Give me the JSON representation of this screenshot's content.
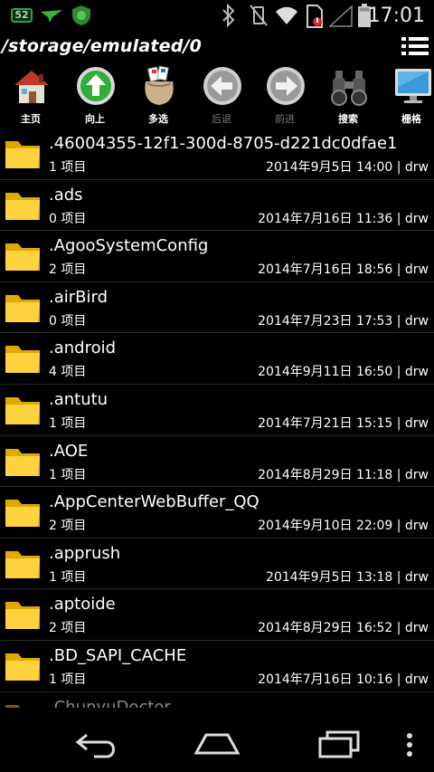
{
  "status_bar": {
    "badge": "52",
    "time": "17:01",
    "icons": [
      "bird-notification-icon",
      "shield-notification-icon",
      "bluetooth-icon",
      "vibrate-off-icon",
      "wifi-icon",
      "sim-error-icon",
      "signal-icon",
      "battery-icon"
    ]
  },
  "path": "/storage/emulated/0",
  "toolbar": {
    "home": "主页",
    "up": "向上",
    "multi": "多选",
    "back": "后退",
    "forward": "前进",
    "search": "搜索",
    "grid": "栅格"
  },
  "files": [
    {
      "name": ".46004355-12f1-300d-8705-d221dc0dfae1",
      "count": "1 项目",
      "meta": "2014年9月5日 14:00 | drw"
    },
    {
      "name": ".ads",
      "count": "0 项目",
      "meta": "2014年7月16日 11:36 | drw"
    },
    {
      "name": ".AgooSystemConfig",
      "count": "2 项目",
      "meta": "2014年7月16日 18:56 | drw"
    },
    {
      "name": ".airBird",
      "count": "0 项目",
      "meta": "2014年7月23日 17:53 | drw"
    },
    {
      "name": ".android",
      "count": "4 项目",
      "meta": "2014年9月11日 16:50 | drw"
    },
    {
      "name": ".antutu",
      "count": "1 项目",
      "meta": "2014年7月21日 15:15 | drw"
    },
    {
      "name": ".AOE",
      "count": "1 项目",
      "meta": "2014年8月29日 11:18 | drw"
    },
    {
      "name": ".AppCenterWebBuffer_QQ",
      "count": "2 项目",
      "meta": "2014年9月10日 22:09 | drw"
    },
    {
      "name": ".apprush",
      "count": "1 项目",
      "meta": "2014年9月5日 13:18 | drw"
    },
    {
      "name": ".aptoide",
      "count": "2 项目",
      "meta": "2014年8月29日 16:52 | drw"
    },
    {
      "name": ".BD_SAPI_CACHE",
      "count": "1 项目",
      "meta": "2014年7月16日 10:16 | drw"
    },
    {
      "name": ".ChunyuDoctor",
      "count": "",
      "meta": ""
    }
  ]
}
